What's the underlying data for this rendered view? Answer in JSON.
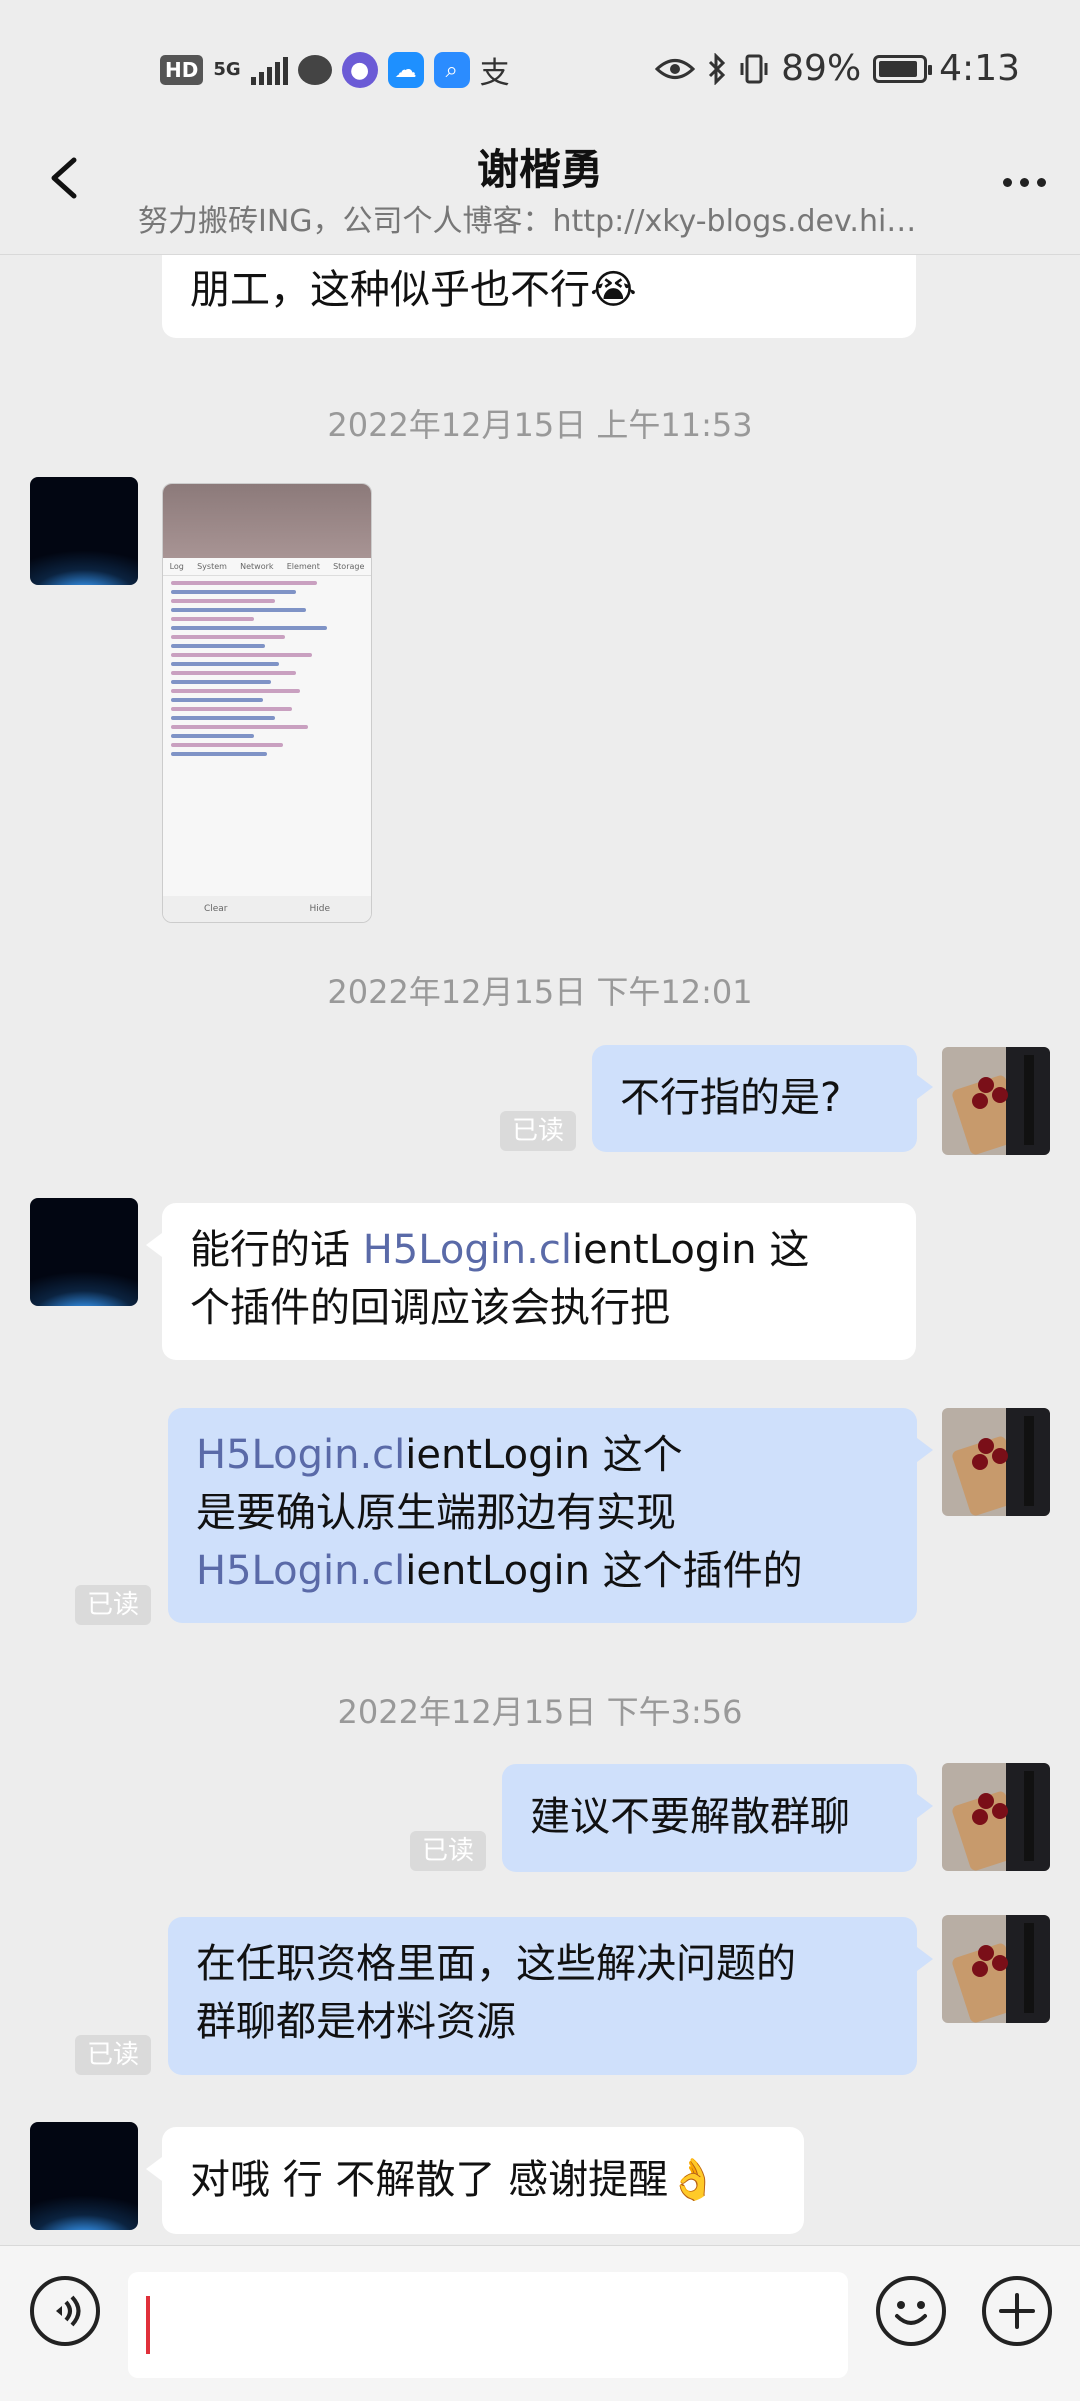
{
  "status_bar": {
    "hd": "HD",
    "network": "5G",
    "battery_percent": "89%",
    "battery_level": 0.89,
    "time": "4:13"
  },
  "header": {
    "title": "谢楷勇",
    "subtitle": "努力搬砖ING，公司个人博客：http://xky-blogs.dev.hi…"
  },
  "messages": {
    "m0": "朋工，这种似乎也不行😭",
    "ts1": "2022年12月15日 上午11:53",
    "ts2": "2022年12月15日 下午12:01",
    "m2": "不行指的是?",
    "m3_link": "H5Login.cl",
    "m3_a": "ientLogin 这",
    "m3_b": "个插件的回调应该会执行把",
    "m4_link1": "H5Login.cl",
    "m4_a": "ientLogin 这个",
    "m4_b": "是要确认原生端那边有实现",
    "m4_link2": "H5Login.cl",
    "m4_c": "ientLogin 这个插件的",
    "ts3": "2022年12月15日 下午3:56",
    "m5": "建议不要解散群聊",
    "m6_a": "在任职资格里面，这些解决问题的",
    "m6_b": "群聊都是材料资源",
    "m7": "对哦 行 不解散了 感谢提醒👌"
  },
  "read_label": "已读",
  "screenshot_tabs": [
    "Log",
    "System",
    "Network",
    "Element",
    "Storage"
  ],
  "screenshot_footer": [
    "Clear",
    "Hide"
  ],
  "icons": [
    "back-arrow-icon",
    "more-dots-icon",
    "voice-icon",
    "emoji-icon",
    "plus-icon"
  ]
}
